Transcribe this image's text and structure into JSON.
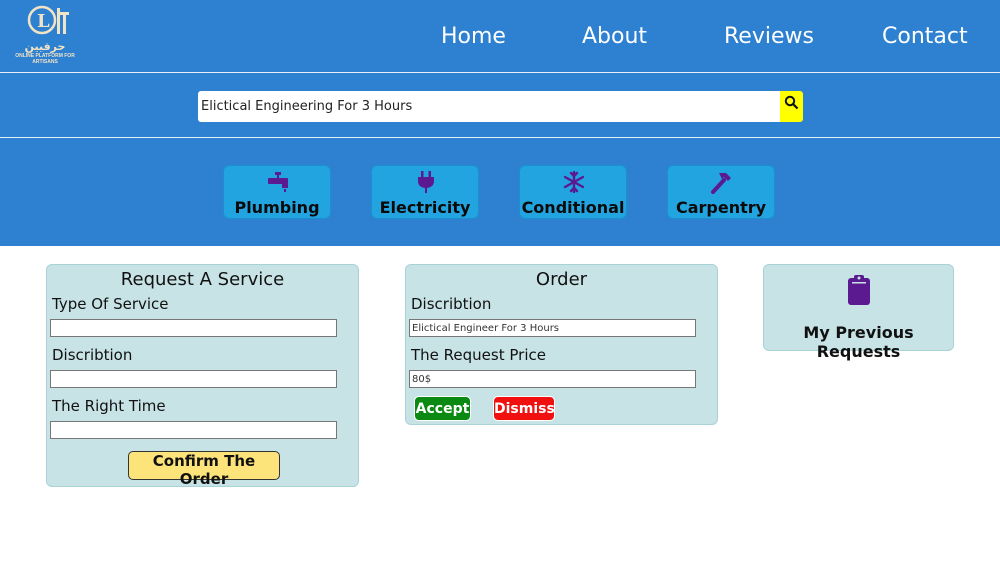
{
  "logo": {
    "arabic_text": "حرفيين",
    "tagline": "ONLINE PLATFORM FOR ARTISANS"
  },
  "nav": [
    "Home",
    "About",
    "Reviews",
    "Contact"
  ],
  "search": {
    "value": "Elictical Engineering For 3 Hours",
    "icon": "search-icon"
  },
  "categories": [
    {
      "label": "Plumbing",
      "icon": "faucet-icon"
    },
    {
      "label": "Electricity",
      "icon": "plug-icon"
    },
    {
      "label": "Conditional",
      "icon": "snowflake-icon"
    },
    {
      "label": "Carpentry",
      "icon": "hammer-icon"
    }
  ],
  "request_panel": {
    "title": "Request A Service",
    "fields": [
      {
        "label": "Type Of Service",
        "value": ""
      },
      {
        "label": "Discribtion",
        "value": ""
      },
      {
        "label": "The Right Time",
        "value": ""
      }
    ],
    "confirm_label": "Confirm The Order"
  },
  "order_panel": {
    "title": "Order",
    "description_label": "Discribtion",
    "description_value": "Elictical Engineer For 3 Hours",
    "price_label": "The Request Price",
    "price_value": "80$",
    "accept_label": "Accept",
    "dismiss_label": "Dismiss"
  },
  "previous": {
    "label": "My Previous Requests",
    "icon": "clipboard-icon"
  },
  "colors": {
    "header": "#2e80d0",
    "category": "#22a4e0",
    "panel": "#c8e3e6",
    "search_button": "#ffff00",
    "accept": "#0a8a12",
    "dismiss": "#f01010",
    "confirm": "#fde47a",
    "icon": "#5b1a8f"
  }
}
